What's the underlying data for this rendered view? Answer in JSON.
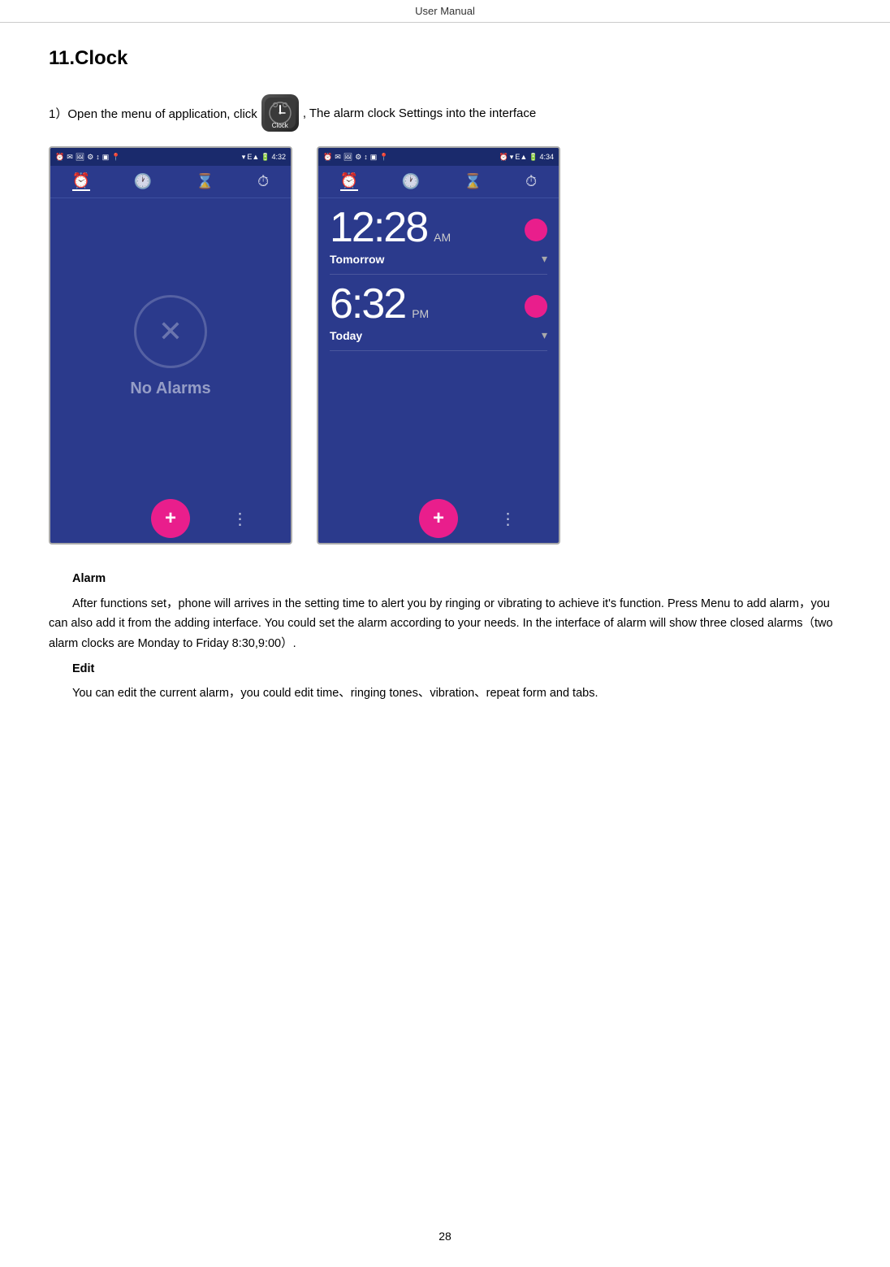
{
  "header": {
    "text": "User    Manual"
  },
  "section": {
    "number": "11.",
    "title": "Clock"
  },
  "step1": {
    "prefix": "1）Open the menu of application, click",
    "suffix": ", The alarm clock Settings into the interface"
  },
  "phone_left": {
    "status_time": "4:32",
    "tab_icons": [
      "⏰",
      "🕐",
      "⌛",
      "⏱"
    ],
    "no_alarms_text": "No Alarms",
    "fab_label": "+",
    "dots": "⋮"
  },
  "phone_right": {
    "status_time": "4:34",
    "tab_icons": [
      "⏰",
      "🕐",
      "⌛",
      "⏱"
    ],
    "alarm1": {
      "time": "12:28",
      "ampm": "AM",
      "label": "Tomorrow"
    },
    "alarm2": {
      "time": "6:32",
      "ampm": "PM",
      "label": "Today"
    },
    "fab_label": "+",
    "dots": "⋮"
  },
  "body_text": {
    "alarm_heading": "Alarm",
    "alarm_para": "After functions set，phone will arrives in the setting time to alert you by ringing or vibrating to achieve it's function. Press Menu to add alarm，you can also add it from the adding interface. You could set the alarm according to your needs. In the interface of alarm will show three closed alarms（two alarm clocks are Monday to Friday 8:30,9:00）.",
    "edit_heading": "Edit",
    "edit_para": "You can edit the current alarm，you could edit time、ringing tones、vibration、repeat form and tabs."
  },
  "page_number": "28"
}
